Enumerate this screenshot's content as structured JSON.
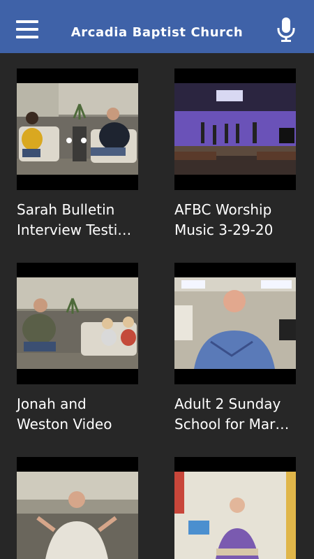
{
  "header": {
    "title": "Arcadia Baptist Church",
    "menu_icon": "hamburger-menu-icon",
    "mic_icon": "microphone-icon",
    "bg_color": "#3f62a8"
  },
  "videos": [
    {
      "title": "Sarah Bulletin\nInterview Testi…"
    },
    {
      "title": "AFBC Worship\nMusic 3-29-20"
    },
    {
      "title": "Jonah and\nWeston Video"
    },
    {
      "title": "Adult 2 Sunday\nSchool for Mar…"
    },
    {
      "title": ""
    },
    {
      "title": ""
    }
  ]
}
